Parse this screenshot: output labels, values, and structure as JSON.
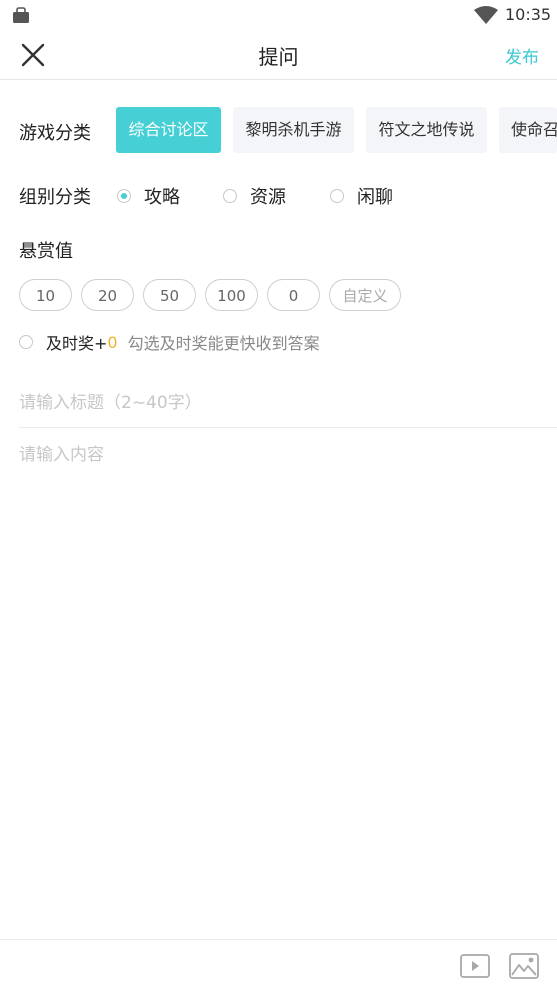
{
  "status_bar": {
    "time": "10:35"
  },
  "header": {
    "title": "提问",
    "publish_label": "发布"
  },
  "game_category": {
    "label": "游戏分类",
    "items": [
      "综合讨论区",
      "黎明杀机手游",
      "符文之地传说",
      "使命召唤"
    ],
    "selected_index": 0
  },
  "group_category": {
    "label": "组别分类",
    "options": [
      "攻略",
      "资源",
      "闲聊"
    ],
    "selected_index": 0
  },
  "reward": {
    "label": "悬赏值",
    "values": [
      "10",
      "20",
      "50",
      "100",
      "0"
    ],
    "custom_label": "自定义"
  },
  "timely_bonus": {
    "label": "及时奖+",
    "value": "0",
    "hint": "勾选及时奖能更快收到答案"
  },
  "form": {
    "title_placeholder": "请输入标题（2~40字）",
    "content_placeholder": "请输入内容"
  },
  "colors": {
    "accent": "#46cfd5",
    "publish": "#3bc8d3",
    "bonus": "#f0b22f"
  }
}
